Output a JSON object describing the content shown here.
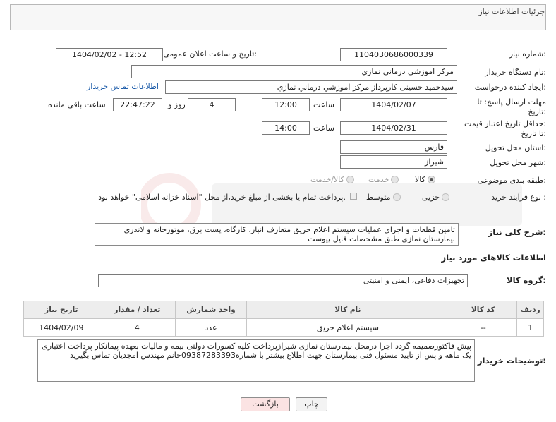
{
  "header": {
    "title": "جزئیات اطلاعات نیاز"
  },
  "fields": {
    "need_number_label": "شماره نیاز:",
    "need_number": "1104030686000339",
    "announce_label": "تاریخ و ساعت اعلان عمومی:",
    "announce_value": "1404/02/02 - 12:52",
    "buyer_org_label": "نام دستگاه خریدار:",
    "buyer_org": "مرکز اموزشي درماني نمازي",
    "creator_label": "ایجاد کننده درخواست:",
    "creator": "سیدحمید حسینی کارپرداز مرکز اموزشي درماني نمازي",
    "contact_link": "اطلاعات تماس خریدار",
    "reply_deadline_label_1": "مهلت ارسال پاسخ: تا",
    "reply_deadline_label_2": "تاریخ:",
    "reply_date": "1404/02/07",
    "time_label": "ساعت",
    "reply_time": "12:00",
    "days_value": "4",
    "days_label": "روز و",
    "remaining_time": "22:47:22",
    "remaining_label": "ساعت باقی مانده",
    "price_validity_label_1": "حداقل تاریخ اعتبار قیمت:",
    "price_validity_label_2": "تا تاریخ:",
    "price_date": "1404/02/31",
    "price_time": "14:00",
    "province_label": "استان محل تحویل:",
    "province": "فارس",
    "city_label": "شهر محل تحویل:",
    "city": "شیراز",
    "category_label": "طبقه بندی موضوعی:",
    "category_options": [
      "کالا",
      "خدمت",
      "کالا/خدمت"
    ],
    "process_label": "نوع فرآیند خرید :",
    "process_options": [
      "جزیی",
      "متوسط"
    ],
    "payment_note": "پرداخت تمام یا بخشی از مبلغ خرید،از محل \"اسناد خزانه اسلامی\" خواهد بود."
  },
  "description": {
    "label": "شرح کلی نیاز:",
    "text": "تامین قطعات و اجرای عملیات سیستم اعلام حریق متعارف انبار، کارگاه، پست برق، موتورخانه و لاندری بیمارستان نمازی طبق مشخصات فایل پیوست"
  },
  "goods": {
    "section_title": "اطلاعات کالاهای مورد نیاز",
    "group_label": "گروه کالا:",
    "group_value": "تجهیزات دفاعی، ایمنی و امنیتی",
    "columns": [
      "ردیف",
      "کد کالا",
      "نام کالا",
      "واحد شمارش",
      "تعداد / مقدار",
      "تاریخ نیاز"
    ],
    "rows": [
      {
        "row": "1",
        "code": "--",
        "name": "سیستم اعلام حریق",
        "unit": "عدد",
        "qty": "4",
        "date": "1404/02/09"
      }
    ]
  },
  "buyer_notes": {
    "label": "توضیحات خریدار:",
    "text": "پیش فاکتورضمیمه گردد اجرا درمحل بیمارستان نمازی شیرازپرداخت کلیه کسورات دولتی بیمه و مالیات بعهده پیمانکار پرداخت اعتباری یک ماهه و پس از تایید مسئول فنی بیمارستان جهت اطلاع بیشتر با شماره09387283393خانم مهندس امجدیان تماس بگیرید"
  },
  "buttons": {
    "print": "چاپ",
    "back": "بازگشت"
  },
  "colors": {
    "back_button_bg": "#fbe3e3",
    "link": "#1a5aa8"
  }
}
